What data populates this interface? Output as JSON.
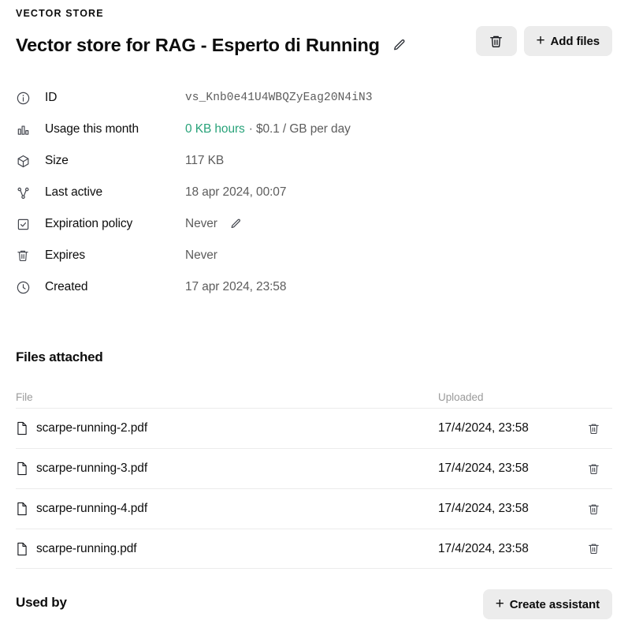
{
  "header": {
    "eyebrow": "VECTOR STORE",
    "title": "Vector store for RAG - Esperto di Running",
    "edit_icon": "pencil-icon",
    "delete_button_icon": "trash-icon",
    "add_files_label": "Add files",
    "add_files_plus": "+"
  },
  "colors": {
    "accent_green": "#29a37a",
    "button_bg": "#ececec",
    "text_primary": "#0d0d0d",
    "text_secondary": "#5d5d5d",
    "text_muted": "#9b9b9b",
    "divider": "#ececec"
  },
  "metadata": [
    {
      "icon": "info-circle-icon",
      "label": "ID",
      "value": "vs_Knb0e41U4WBQZyEag20N4iN3",
      "mono": true
    },
    {
      "icon": "bar-chart-icon",
      "label": "Usage this month",
      "value_green": "0 KB hours",
      "value_rest": "· $0.1 / GB per day"
    },
    {
      "icon": "cube-icon",
      "label": "Size",
      "value": "117 KB"
    },
    {
      "icon": "share-nodes-icon",
      "label": "Last active",
      "value": "18 apr 2024, 00:07"
    },
    {
      "icon": "checkbox-checked-icon",
      "label": "Expiration policy",
      "value": "Never",
      "edit_icon": "pencil-icon"
    },
    {
      "icon": "trash-icon",
      "label": "Expires",
      "value": "Never"
    },
    {
      "icon": "clock-icon",
      "label": "Created",
      "value": "17 apr 2024, 23:58"
    }
  ],
  "files_section": {
    "title": "Files attached",
    "columns": {
      "file": "File",
      "uploaded": "Uploaded"
    },
    "rows": [
      {
        "name": "scarpe-running-2.pdf",
        "uploaded": "17/4/2024, 23:58",
        "delete_icon": "trash-icon"
      },
      {
        "name": "scarpe-running-3.pdf",
        "uploaded": "17/4/2024, 23:58",
        "delete_icon": "trash-icon"
      },
      {
        "name": "scarpe-running-4.pdf",
        "uploaded": "17/4/2024, 23:58",
        "delete_icon": "trash-icon"
      },
      {
        "name": "scarpe-running.pdf",
        "uploaded": "17/4/2024, 23:58",
        "delete_icon": "trash-icon"
      }
    ]
  },
  "used_by": {
    "title": "Used by",
    "create_assistant_label": "Create assistant",
    "create_assistant_plus": "+"
  }
}
